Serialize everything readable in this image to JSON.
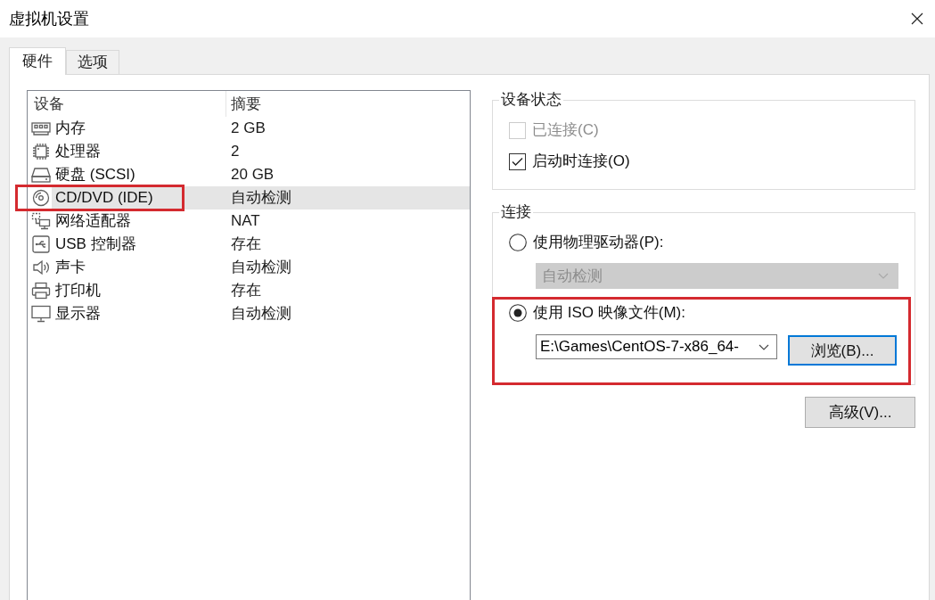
{
  "window": {
    "title": "虚拟机设置"
  },
  "tabs": [
    {
      "label": "硬件",
      "selected": true
    },
    {
      "label": "选项",
      "selected": false
    }
  ],
  "device_list": {
    "columns": [
      "设备",
      "摘要"
    ],
    "devices": [
      {
        "kind": "memory",
        "name": "内存",
        "summary": "2 GB",
        "selected": false,
        "annotated": false
      },
      {
        "kind": "processor",
        "name": "处理器",
        "summary": "2",
        "selected": false,
        "annotated": false
      },
      {
        "kind": "hard_disk",
        "name": "硬盘 (SCSI)",
        "summary": "20 GB",
        "selected": false,
        "annotated": false
      },
      {
        "kind": "cd_dvd",
        "name": "CD/DVD (IDE)",
        "summary": "自动检测",
        "selected": true,
        "annotated": true
      },
      {
        "kind": "network",
        "name": "网络适配器",
        "summary": "NAT",
        "selected": false,
        "annotated": false
      },
      {
        "kind": "usb",
        "name": "USB 控制器",
        "summary": "存在",
        "selected": false,
        "annotated": false
      },
      {
        "kind": "sound",
        "name": "声卡",
        "summary": "自动检测",
        "selected": false,
        "annotated": false
      },
      {
        "kind": "printer",
        "name": "打印机",
        "summary": "存在",
        "selected": false,
        "annotated": false
      },
      {
        "kind": "display",
        "name": "显示器",
        "summary": "自动检测",
        "selected": false,
        "annotated": false
      }
    ]
  },
  "device_status": {
    "title": "设备状态",
    "checkboxes": [
      {
        "label": "已连接(C)",
        "checked": false,
        "disabled": true
      },
      {
        "label": "启动时连接(O)",
        "checked": true,
        "disabled": false
      }
    ]
  },
  "connection": {
    "title": "连接",
    "options": [
      {
        "kind": "physical_drive",
        "label": "使用物理驱动器(P):",
        "selected": false,
        "annotated": false,
        "dropdown": {
          "value": "自动检测",
          "disabled": true
        }
      },
      {
        "kind": "iso_image",
        "label": "使用 ISO 映像文件(M):",
        "selected": true,
        "annotated": true,
        "file": {
          "value": "E:\\Games\\CentOS-7-x86_64-"
        },
        "browse_button": {
          "label": "浏览(B)...",
          "focused": true
        }
      }
    ]
  },
  "advanced_button": {
    "label": "高级(V)..."
  }
}
